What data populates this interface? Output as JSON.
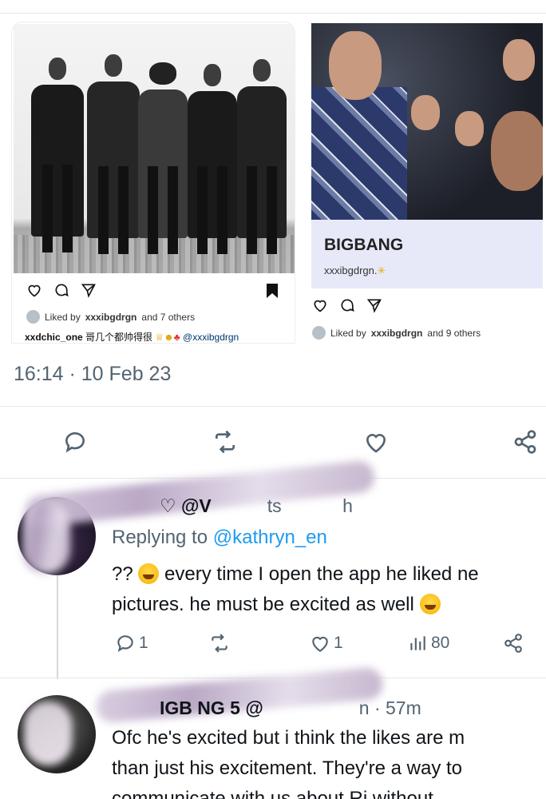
{
  "quoted_post_left": {
    "liked_by_prefix": "Liked by",
    "liked_by_user": "xxxibgdrgn",
    "liked_by_suffix": "and 7 others",
    "caption_user": "xxdchic_one",
    "caption_text": "哥几个都帅得很",
    "caption_mention": "@xxxibgdrgn"
  },
  "quoted_post_right": {
    "title": "BIGBANG",
    "username": "xxxibgdrgn.",
    "liked_by_prefix": "Liked by",
    "liked_by_user": "xxxibgdrgn",
    "liked_by_suffix": "and 9 others"
  },
  "tweet": {
    "timestamp": "16:14 · 10 Feb 23"
  },
  "replies": [
    {
      "name_visible": "♡ @V",
      "handle_fragment": "ts",
      "time": "h",
      "replying_prefix": "Replying to",
      "replying_handle": "@kathryn_en",
      "line1_start": "??",
      "line1_end": "every time I open the app he liked ne",
      "line2": "pictures. he must be excited as well",
      "reply_count": "1",
      "like_count": "1",
      "views": "80"
    },
    {
      "name_visible": "IGB  NG   5 @",
      "handle_fragment": "n",
      "time": "· 57m",
      "line1": "Ofc he's excited but i think the likes are m",
      "line2": "than just his excitement. They're a way to",
      "line3": "communicate with us about Ri without"
    }
  ],
  "colors": {
    "secondary_text": "#536471",
    "link": "#1d9bf0",
    "bigbang_panel": "#e8e9f8"
  },
  "icons": [
    "heart-icon",
    "comment-icon",
    "share-icon",
    "bookmark-icon",
    "reply-icon",
    "retweet-icon",
    "views-icon"
  ]
}
